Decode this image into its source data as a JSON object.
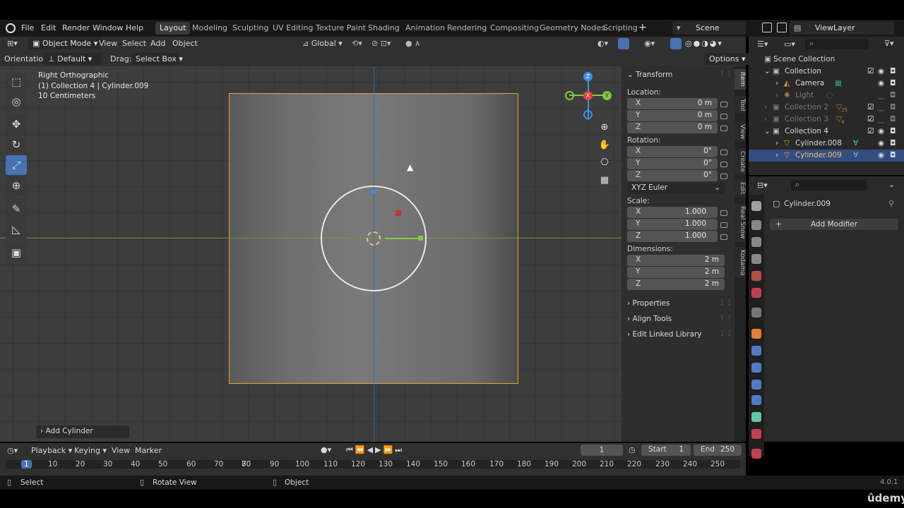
{
  "menubar": {
    "items": [
      "File",
      "Edit",
      "Render",
      "Window",
      "Help"
    ],
    "workspaces": [
      "Layout",
      "Modeling",
      "Sculpting",
      "UV Editing",
      "Texture Paint",
      "Shading",
      "Animation",
      "Rendering",
      "Compositing",
      "Geometry Nodes",
      "Scripting"
    ],
    "active_workspace": "Layout",
    "add_tab": "+",
    "scene": "Scene",
    "view_layer": "ViewLayer"
  },
  "header": {
    "mode": "Object Mode",
    "menus": [
      "View",
      "Select",
      "Add",
      "Object"
    ],
    "transform_orientation": "Global",
    "orientation_label": "Orientation:",
    "orientation_value": "Default",
    "drag_label": "Drag:",
    "drag_value": "Select Box",
    "options": "Options"
  },
  "viewport": {
    "view_name": "Right Orthographic",
    "collection_info": "(1) Collection 4 | Cylinder.009",
    "scale_info": "10 Centimeters",
    "gizmo_axes": {
      "z": "Z",
      "x": "X",
      "y": "Y"
    },
    "last_operator": "Add Cylinder"
  },
  "npanel": {
    "transform": "Transform",
    "location_label": "Location:",
    "rotation_label": "Rotation:",
    "scale_label": "Scale:",
    "dimensions_label": "Dimensions:",
    "location": [
      {
        "axis": "X",
        "value": "0 m"
      },
      {
        "axis": "Y",
        "value": "0 m"
      },
      {
        "axis": "Z",
        "value": "0 m"
      }
    ],
    "rotation": [
      {
        "axis": "X",
        "value": "0°"
      },
      {
        "axis": "Y",
        "value": "0°"
      },
      {
        "axis": "Z",
        "value": "0°"
      }
    ],
    "rotation_mode": "XYZ Euler",
    "scale": [
      {
        "axis": "X",
        "value": "1.000"
      },
      {
        "axis": "Y",
        "value": "1.000"
      },
      {
        "axis": "Z",
        "value": "1.000"
      }
    ],
    "dimensions": [
      {
        "axis": "X",
        "value": "2 m"
      },
      {
        "axis": "Y",
        "value": "2 m"
      },
      {
        "axis": "Z",
        "value": "2 m"
      }
    ],
    "sections": [
      "Properties",
      "Align Tools",
      "Edit Linked Library"
    ],
    "tabs": [
      "Item",
      "Tool",
      "View",
      "Create",
      "Edit",
      "Real Snow",
      "Kodama"
    ]
  },
  "outliner": {
    "root": "Scene Collection",
    "rows": [
      {
        "name": "Collection"
      },
      {
        "name": "Camera"
      },
      {
        "name": "Light"
      },
      {
        "name": "Collection 2",
        "badge": "25"
      },
      {
        "name": "Collection 3",
        "badge": "4"
      },
      {
        "name": "Collection 4"
      },
      {
        "name": "Cylinder.008"
      },
      {
        "name": "Cylinder.009"
      }
    ]
  },
  "properties": {
    "object_name": "Cylinder.009",
    "add_modifier": "Add Modifier"
  },
  "timeline": {
    "menus": [
      "Playback",
      "Keying",
      "View",
      "Marker"
    ],
    "current_frame": "1",
    "start_label": "Start",
    "start": "1",
    "end_label": "End",
    "end": "250",
    "ticks": [
      "1",
      "10",
      "20",
      "30",
      "40",
      "50",
      "60",
      "70",
      "80",
      "90",
      "100",
      "110",
      "120",
      "130",
      "140",
      "150",
      "160",
      "170",
      "180",
      "190",
      "200",
      "210",
      "220",
      "230",
      "240",
      "250"
    ]
  },
  "status": {
    "select": "Select",
    "rotate_view": "Rotate View",
    "object": "Object",
    "version": "4.0.1",
    "watermark": "ûdemy"
  },
  "colors": {
    "accent": "#4772b3",
    "selection_outline": "#e8a040",
    "x_axis": "#e84040",
    "y_axis": "#80c840",
    "z_axis": "#3b8fe8"
  }
}
